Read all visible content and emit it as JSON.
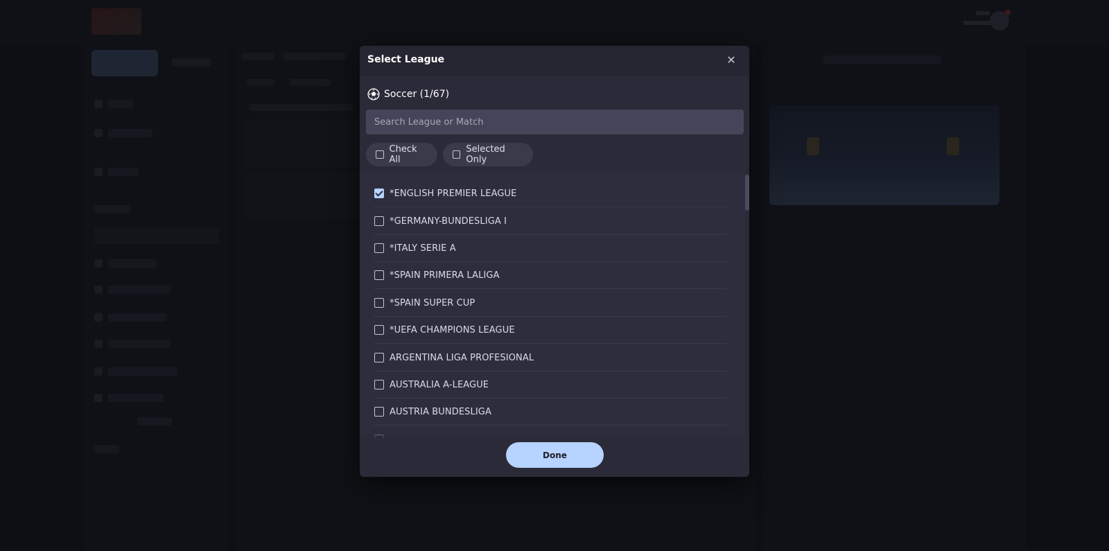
{
  "modal": {
    "title": "Select League",
    "close_glyph": "✕",
    "sport": {
      "icon": "soccer-ball-icon",
      "label": "Soccer (1/67)"
    },
    "search": {
      "placeholder": "Search League or Match",
      "value": ""
    },
    "filters": {
      "check_all": {
        "label": "Check All",
        "checked": false
      },
      "selected_only": {
        "label": "Selected Only",
        "checked": false
      }
    },
    "leagues": [
      {
        "label": "*ENGLISH PREMIER LEAGUE",
        "checked": true
      },
      {
        "label": "*GERMANY-BUNDESLIGA I",
        "checked": false
      },
      {
        "label": "*ITALY SERIE A",
        "checked": false
      },
      {
        "label": "*SPAIN PRIMERA LALIGA",
        "checked": false
      },
      {
        "label": "*SPAIN SUPER CUP",
        "checked": false
      },
      {
        "label": "*UEFA CHAMPIONS LEAGUE",
        "checked": false
      },
      {
        "label": "ARGENTINA LIGA PROFESIONAL",
        "checked": false
      },
      {
        "label": "AUSTRALIA A-LEAGUE",
        "checked": false
      },
      {
        "label": "AUSTRIA BUNDESLIGA",
        "checked": false
      }
    ],
    "done_label": "Done"
  },
  "colors": {
    "accent": "#b7d3ff",
    "modal_bg": "#2a2a38",
    "search_bg": "#454559"
  }
}
